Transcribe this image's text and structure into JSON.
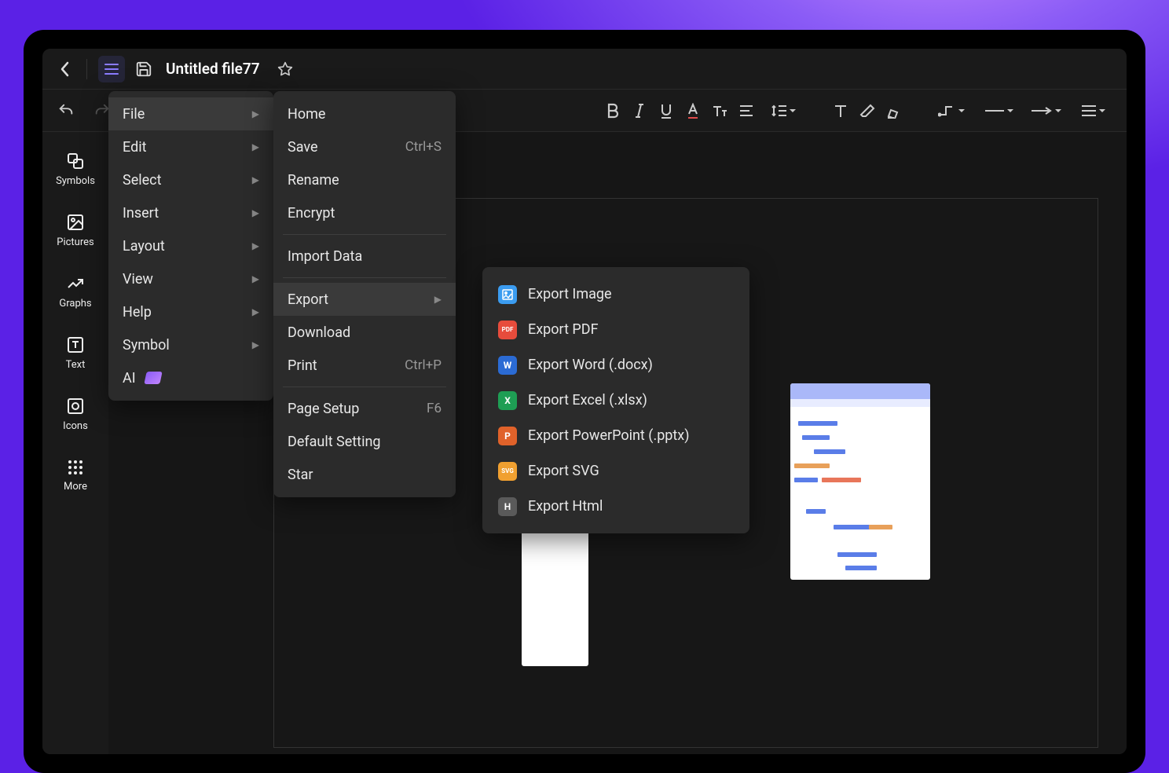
{
  "title": "Untitled file77",
  "sidebar": [
    {
      "label": "Symbols"
    },
    {
      "label": "Pictures"
    },
    {
      "label": "Graphs"
    },
    {
      "label": "Text"
    },
    {
      "label": "Icons"
    },
    {
      "label": "More"
    }
  ],
  "menu1": [
    {
      "label": "File",
      "arrow": true,
      "active": true
    },
    {
      "label": "Edit",
      "arrow": true
    },
    {
      "label": "Select",
      "arrow": true
    },
    {
      "label": "Insert",
      "arrow": true
    },
    {
      "label": "Layout",
      "arrow": true
    },
    {
      "label": "View",
      "arrow": true
    },
    {
      "label": "Help",
      "arrow": true
    },
    {
      "label": "Symbol",
      "arrow": true
    },
    {
      "label": "AI",
      "ai": true
    }
  ],
  "menu2_groups": [
    [
      {
        "label": "Home"
      },
      {
        "label": "Save",
        "shortcut": "Ctrl+S"
      },
      {
        "label": "Rename"
      },
      {
        "label": "Encrypt"
      }
    ],
    [
      {
        "label": "Import Data"
      }
    ],
    [
      {
        "label": "Export",
        "arrow": true,
        "active": true
      },
      {
        "label": "Download"
      },
      {
        "label": "Print",
        "shortcut": "Ctrl+P"
      }
    ],
    [
      {
        "label": "Page Setup",
        "shortcut": "F6"
      },
      {
        "label": "Default Setting"
      },
      {
        "label": "Star"
      }
    ]
  ],
  "menu3": [
    {
      "label": "Export Image",
      "icon": "img",
      "color": "#3b9cf0"
    },
    {
      "label": "Export PDF",
      "icon": "PDF",
      "color": "#e74c3c"
    },
    {
      "label": "Export Word (.docx)",
      "icon": "W",
      "color": "#2b6bd4"
    },
    {
      "label": "Export Excel (.xlsx)",
      "icon": "X",
      "color": "#1e9e54"
    },
    {
      "label": "Export PowerPoint (.pptx)",
      "icon": "P",
      "color": "#e0622a"
    },
    {
      "label": "Export SVG",
      "icon": "SVG",
      "color": "#f0a030"
    },
    {
      "label": "Export Html",
      "icon": "H",
      "color": "#5a5a5a"
    }
  ]
}
